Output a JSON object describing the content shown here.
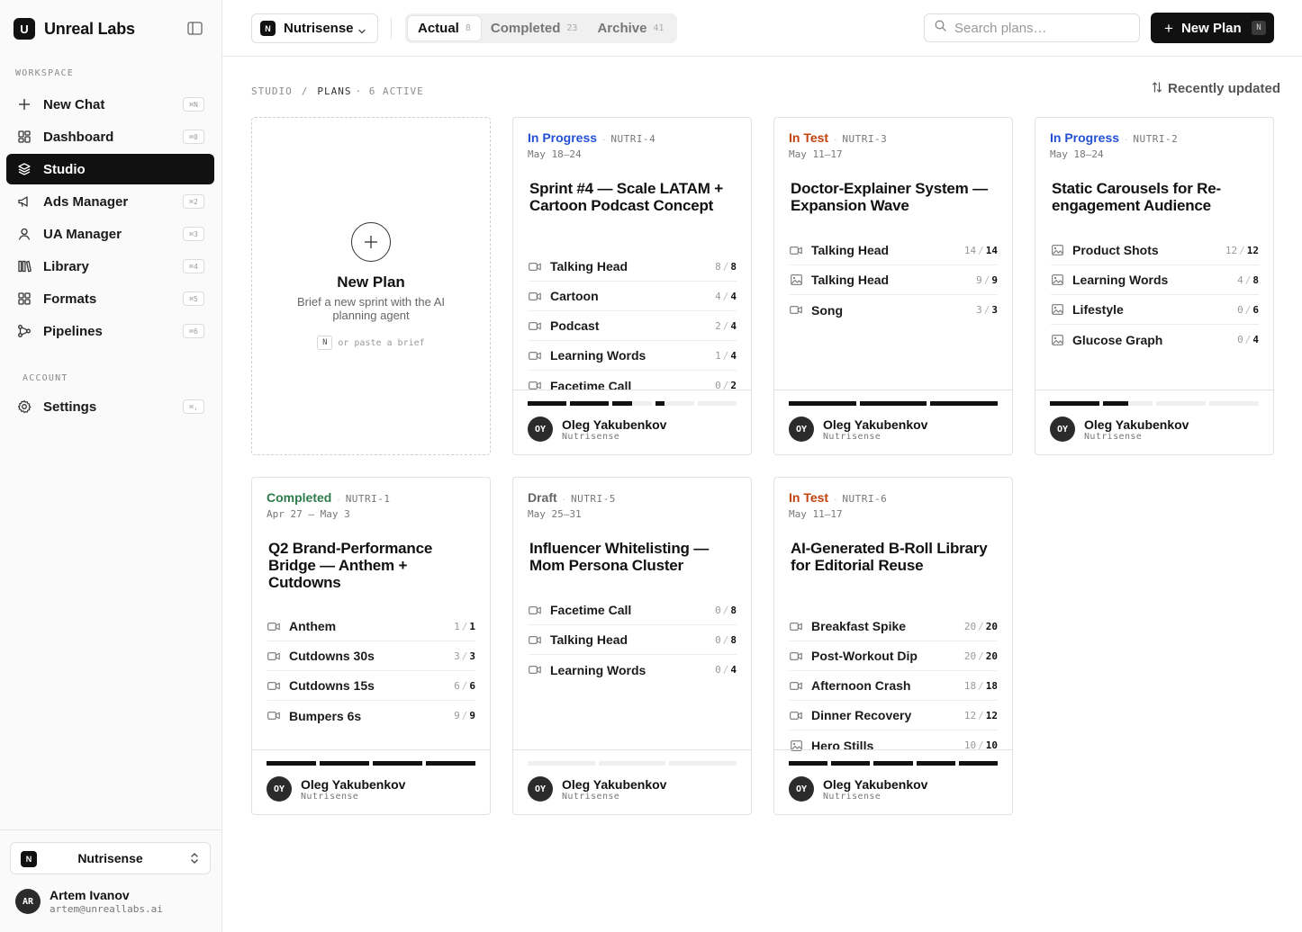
{
  "brand": {
    "logo_letter": "U",
    "name": "Unreal Labs"
  },
  "sidebar": {
    "workspace_label": "WORKSPACE",
    "account_label": "ACCOUNT",
    "items": [
      {
        "label": "New Chat",
        "shortcut": "⌘N",
        "icon": "plus-icon"
      },
      {
        "label": "Dashboard",
        "shortcut": "⌘0",
        "icon": "dashboard-icon"
      },
      {
        "label": "Studio",
        "shortcut": "",
        "icon": "layers-icon",
        "active": true
      },
      {
        "label": "Ads Manager",
        "shortcut": "⌘2",
        "icon": "megaphone-icon"
      },
      {
        "label": "UA Manager",
        "shortcut": "⌘3",
        "icon": "user-icon"
      },
      {
        "label": "Library",
        "shortcut": "⌘4",
        "icon": "library-icon"
      },
      {
        "label": "Formats",
        "shortcut": "⌘5",
        "icon": "grid-icon"
      },
      {
        "label": "Pipelines",
        "shortcut": "⌘6",
        "icon": "pipeline-icon"
      }
    ],
    "settings": {
      "label": "Settings",
      "shortcut": "⌘,",
      "icon": "gear-icon"
    },
    "workspace_select": {
      "badge": "N",
      "name": "Nutrisense"
    },
    "user": {
      "initials": "AR",
      "name": "Artem Ivanov",
      "email": "artem@unreallabs.ai"
    }
  },
  "topbar": {
    "project": {
      "badge": "N",
      "name": "Nutrisense"
    },
    "tabs": [
      {
        "label": "Actual",
        "count": "8",
        "active": true
      },
      {
        "label": "Completed",
        "count": "23",
        "active": false
      },
      {
        "label": "Archive",
        "count": "41",
        "active": false
      }
    ],
    "search_placeholder": "Search plans…",
    "new_plan": {
      "label": "New Plan",
      "shortcut": "N"
    }
  },
  "breadcrumb": {
    "root": "STUDIO",
    "sep": "/",
    "current": "PLANS",
    "meta": "· 6 ACTIVE"
  },
  "sort_label": "Recently updated",
  "new_card": {
    "title": "New Plan",
    "description": "Brief a new sprint with the AI planning agent",
    "hint_key": "N",
    "hint_text": "or paste a brief"
  },
  "colors": {
    "in_progress": "#2450d6",
    "in_test": "#c2410c",
    "completed": "#2f7a4a",
    "draft": "#666666"
  },
  "plans": [
    {
      "status": "In Progress",
      "status_kind": "in_progress",
      "id": "NUTRI-4",
      "dates": "May 18–24",
      "title": "Sprint #4 — Scale LATAM + Cartoon Podcast Concept",
      "rows": [
        {
          "name": "Talking Head",
          "done": "8",
          "total": "8",
          "icon": "video-icon"
        },
        {
          "name": "Cartoon",
          "done": "4",
          "total": "4",
          "icon": "video-icon"
        },
        {
          "name": "Podcast",
          "done": "2",
          "total": "4",
          "icon": "video-icon"
        },
        {
          "name": "Learning Words",
          "done": "1",
          "total": "4",
          "icon": "video-icon"
        },
        {
          "name": "Facetime Call",
          "done": "0",
          "total": "2",
          "icon": "video-icon"
        }
      ],
      "owner": {
        "initials": "OY",
        "name": "Oleg Yakubenkov",
        "org": "Nutrisense"
      }
    },
    {
      "status": "In Test",
      "status_kind": "in_test",
      "id": "NUTRI-3",
      "dates": "May 11–17",
      "title": "Doctor-Explainer System — Expansion Wave",
      "rows": [
        {
          "name": "Talking Head",
          "done": "14",
          "total": "14",
          "icon": "video-icon"
        },
        {
          "name": "Talking Head",
          "done": "9",
          "total": "9",
          "icon": "image-icon"
        },
        {
          "name": "Song",
          "done": "3",
          "total": "3",
          "icon": "video-icon"
        }
      ],
      "owner": {
        "initials": "OY",
        "name": "Oleg Yakubenkov",
        "org": "Nutrisense"
      }
    },
    {
      "status": "In Progress",
      "status_kind": "in_progress",
      "id": "NUTRI-2",
      "dates": "May 18–24",
      "title": "Static Carousels for Re-engagement Audience",
      "rows": [
        {
          "name": "Product Shots",
          "done": "12",
          "total": "12",
          "icon": "image-icon"
        },
        {
          "name": "Learning Words",
          "done": "4",
          "total": "8",
          "icon": "image-icon"
        },
        {
          "name": "Lifestyle",
          "done": "0",
          "total": "6",
          "icon": "image-icon"
        },
        {
          "name": "Glucose Graph",
          "done": "0",
          "total": "4",
          "icon": "image-icon"
        }
      ],
      "owner": {
        "initials": "OY",
        "name": "Oleg Yakubenkov",
        "org": "Nutrisense"
      }
    },
    {
      "status": "Completed",
      "status_kind": "completed",
      "id": "NUTRI-1",
      "dates": "Apr 27 — May 3",
      "title": "Q2 Brand-Performance Bridge — Anthem + Cutdowns",
      "rows": [
        {
          "name": "Anthem",
          "done": "1",
          "total": "1",
          "icon": "video-icon"
        },
        {
          "name": "Cutdowns 30s",
          "done": "3",
          "total": "3",
          "icon": "video-icon"
        },
        {
          "name": "Cutdowns 15s",
          "done": "6",
          "total": "6",
          "icon": "video-icon"
        },
        {
          "name": "Bumpers 6s",
          "done": "9",
          "total": "9",
          "icon": "video-icon"
        }
      ],
      "owner": {
        "initials": "OY",
        "name": "Oleg Yakubenkov",
        "org": "Nutrisense"
      }
    },
    {
      "status": "Draft",
      "status_kind": "draft",
      "id": "NUTRI-5",
      "dates": "May 25–31",
      "title": "Influencer Whitelisting — Mom Persona Cluster",
      "rows": [
        {
          "name": "Facetime Call",
          "done": "0",
          "total": "8",
          "icon": "video-icon"
        },
        {
          "name": "Talking Head",
          "done": "0",
          "total": "8",
          "icon": "video-icon"
        },
        {
          "name": "Learning Words",
          "done": "0",
          "total": "4",
          "icon": "video-icon"
        }
      ],
      "owner": {
        "initials": "OY",
        "name": "Oleg Yakubenkov",
        "org": "Nutrisense"
      }
    },
    {
      "status": "In Test",
      "status_kind": "in_test",
      "id": "NUTRI-6",
      "dates": "May 11–17",
      "title": "AI-Generated B-Roll Library for Editorial Reuse",
      "rows": [
        {
          "name": "Breakfast Spike",
          "done": "20",
          "total": "20",
          "icon": "video-icon"
        },
        {
          "name": "Post-Workout Dip",
          "done": "20",
          "total": "20",
          "icon": "video-icon"
        },
        {
          "name": "Afternoon Crash",
          "done": "18",
          "total": "18",
          "icon": "video-icon"
        },
        {
          "name": "Dinner Recovery",
          "done": "12",
          "total": "12",
          "icon": "video-icon"
        },
        {
          "name": "Hero Stills",
          "done": "10",
          "total": "10",
          "icon": "image-icon"
        }
      ],
      "owner": {
        "initials": "OY",
        "name": "Oleg Yakubenkov",
        "org": "Nutrisense"
      }
    }
  ]
}
